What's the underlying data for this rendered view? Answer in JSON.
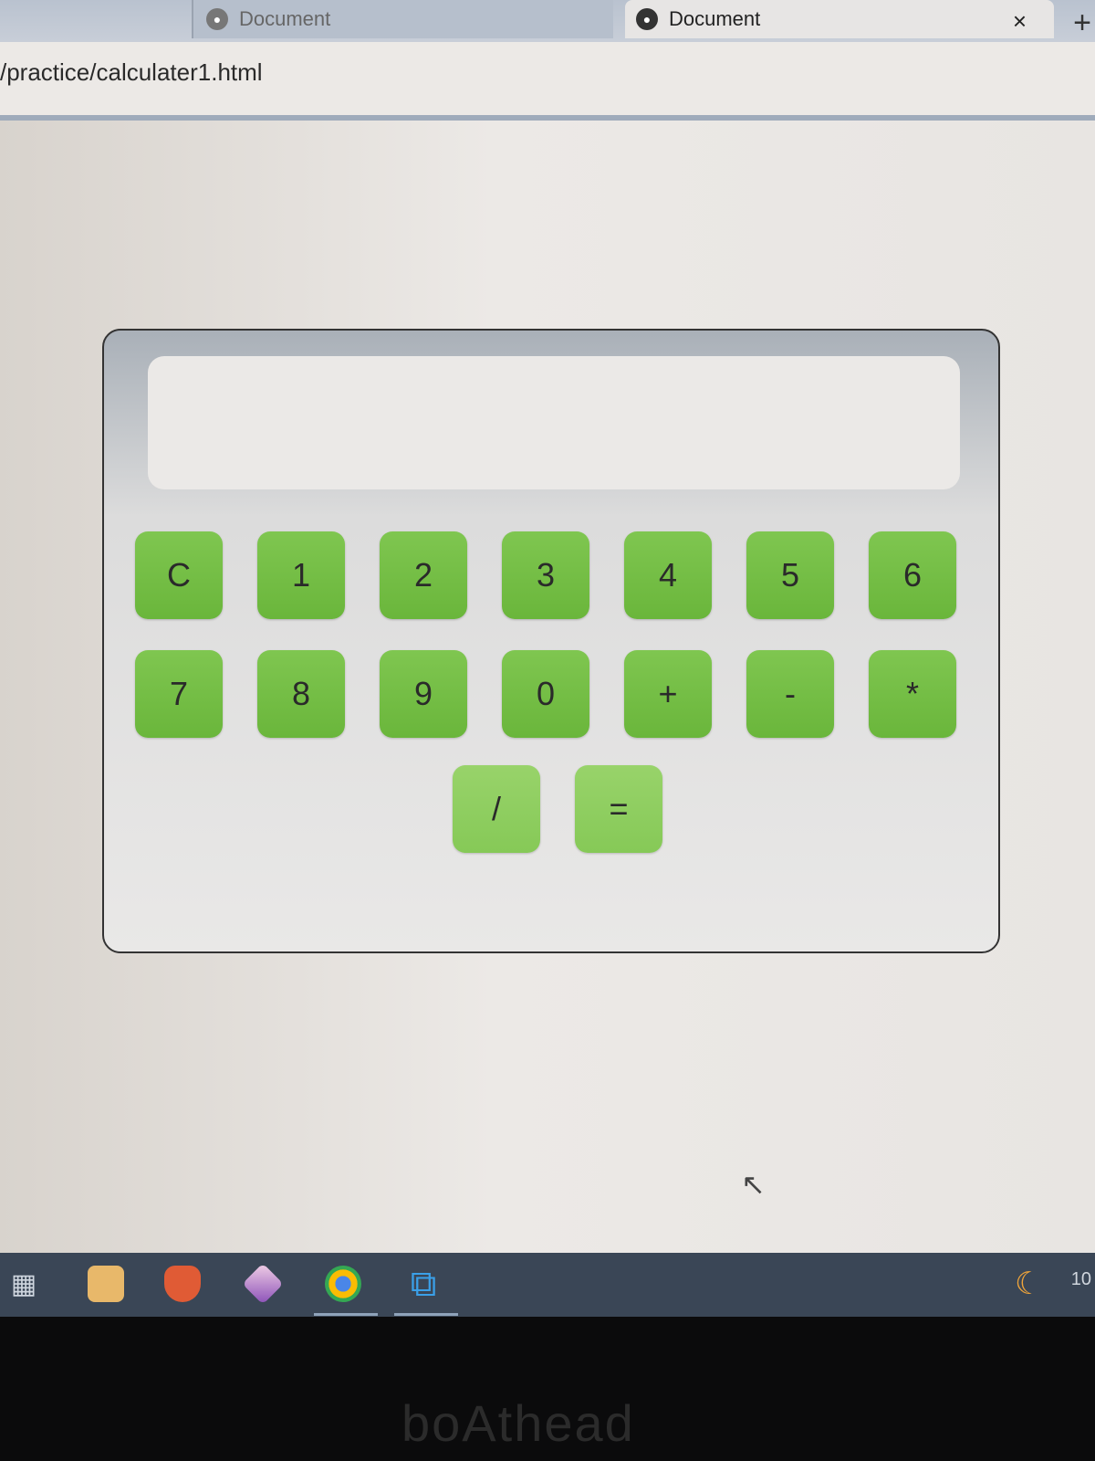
{
  "browser": {
    "tabs": [
      {
        "title": "Document",
        "active": false
      },
      {
        "title": "Document",
        "active": true
      }
    ],
    "close_glyph": "×",
    "new_tab_glyph": "+",
    "url": "/practice/calculater1.html"
  },
  "calculator": {
    "display_value": "",
    "row1": [
      "C",
      "1",
      "2",
      "3",
      "4",
      "5",
      "6"
    ],
    "row2": [
      "7",
      "8",
      "9",
      "0",
      "+",
      "-",
      "*"
    ],
    "row3": [
      "/",
      "="
    ],
    "key_color": "#74bd46"
  },
  "taskbar": {
    "icons": [
      "task-view-icon",
      "store-icon",
      "brave-icon",
      "app-icon",
      "chrome-icon",
      "vscode-icon"
    ],
    "time": "10"
  },
  "monitor": {
    "brand": "boAthead"
  }
}
